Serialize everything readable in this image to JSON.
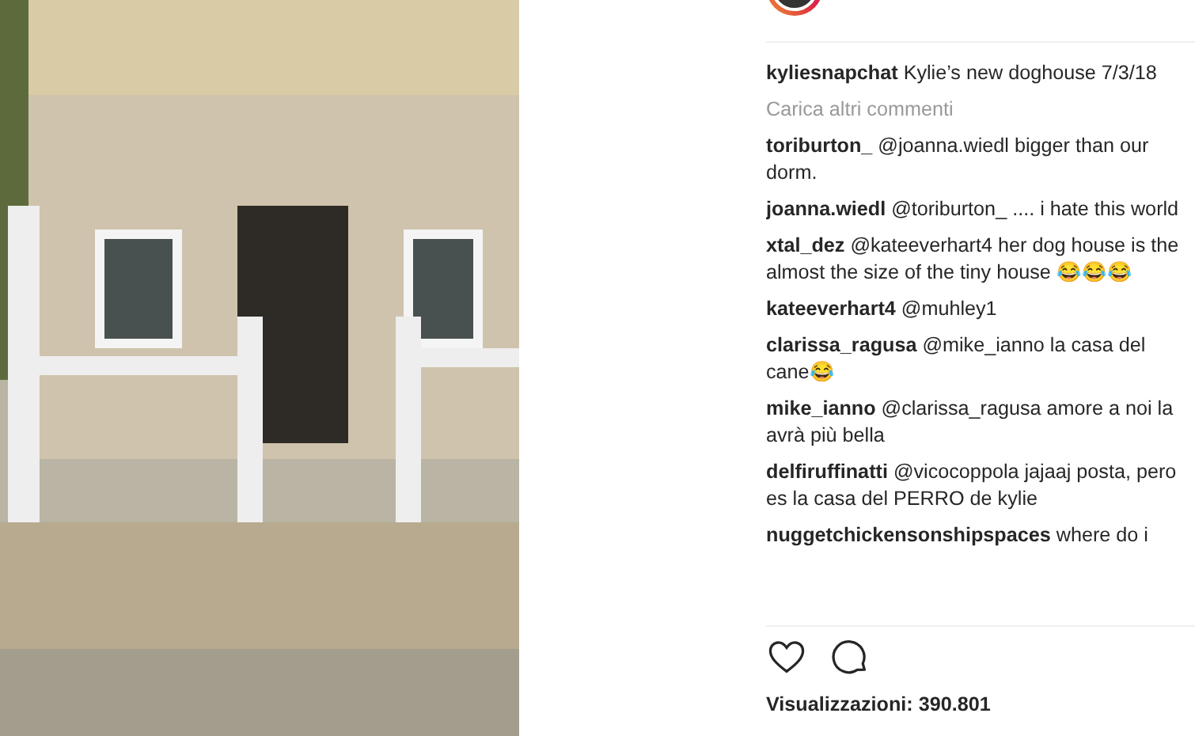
{
  "post": {
    "caption": {
      "username": "kyliesnapchat",
      "text": "Kylie’s new doghouse 7/3/18"
    },
    "load_more": "Carica altri commenti",
    "comments": [
      {
        "username": "toriburton_",
        "text": "@joanna.wiedl bigger than our dorm."
      },
      {
        "username": "joanna.wiedl",
        "text": "@toriburton_ .... i hate this world"
      },
      {
        "username": "xtal_dez",
        "text": "@kateeverhart4 her dog house is the almost the size of the tiny house 😂😂😂"
      },
      {
        "username": "kateeverhart4",
        "text": "@muhley1"
      },
      {
        "username": "clarissa_ragusa",
        "text": "@mike_ianno la casa del cane😂"
      },
      {
        "username": "mike_ianno",
        "text": "@clarissa_ragusa amore a noi la avrà più bella"
      },
      {
        "username": "delfiruffinatti",
        "text": "@vicocoppola jajaaj posta, pero es la casa del PERRO de kylie"
      },
      {
        "username": "nuggetchickensonshipspaces",
        "text": "where do i"
      }
    ],
    "views": "Visualizzazioni: 390.801"
  }
}
